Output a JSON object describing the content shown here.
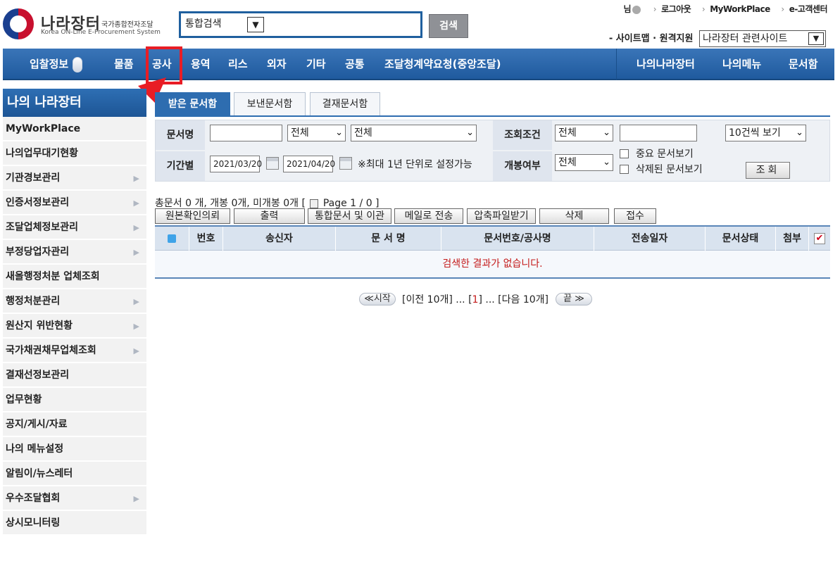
{
  "header": {
    "logo_name": "나라장터",
    "logo_tagline": "국가종합전자조달",
    "logo_english": "Korea ON-Line E-Procurement System",
    "search_scope": "통합검색",
    "search_button": "검색",
    "util_user": "님",
    "util_logout": "로그아웃",
    "util_workplace": "MyWorkPlace",
    "util_customer": "e-고객센터",
    "util_sitemap": "- 사이트맵 · 원격지원",
    "related_sites": "나라장터 관련사이트"
  },
  "nav": {
    "items": [
      "입찰정보",
      "물품",
      "공사",
      "용역",
      "리스",
      "외자",
      "기타",
      "공통",
      "조달청계약요청(중앙조달)"
    ],
    "right_items": [
      "나의나라장터",
      "나의메뉴",
      "문서함"
    ]
  },
  "sidebar": {
    "title": "나의 나라장터",
    "items": [
      {
        "label": "MyWorkPlace",
        "chevron": ""
      },
      {
        "label": "나의업무대기현황",
        "chevron": ""
      },
      {
        "label": "기관경보관리",
        "chevron": "▶"
      },
      {
        "label": "인증서정보관리",
        "chevron": "▶"
      },
      {
        "label": "조달업체정보관리",
        "chevron": "▶"
      },
      {
        "label": "부정당업자관리",
        "chevron": "▶"
      },
      {
        "label": "새올행정처분 업체조회",
        "chevron": ""
      },
      {
        "label": "행정처분관리",
        "chevron": "▶"
      },
      {
        "label": "원산지 위반현황",
        "chevron": "▶"
      },
      {
        "label": "국가채권채무업체조회",
        "chevron": "▶"
      },
      {
        "label": "결재선정보관리",
        "chevron": ""
      },
      {
        "label": "업무현황",
        "chevron": ""
      },
      {
        "label": "공지/게시/자료",
        "chevron": ""
      },
      {
        "label": "나의 메뉴설정",
        "chevron": ""
      },
      {
        "label": "알림이/뉴스레터",
        "chevron": ""
      },
      {
        "label": "우수조달협회",
        "chevron": "▶"
      },
      {
        "label": "상시모니터링",
        "chevron": ""
      }
    ]
  },
  "tabs": [
    "받은 문서함",
    "보낸문서함",
    "결재문서함"
  ],
  "filter": {
    "doc_name_label": "문서명",
    "doc_name_value": "",
    "doc_type_1": "전체",
    "doc_type_2": "전체",
    "query_cond_label": "조회조건",
    "query_cond_value": "전체",
    "query_text_value": "",
    "page_size": "10건씩 보기",
    "period_label": "기간별",
    "date_from": "2021/03/20",
    "date_to": "2021/04/20",
    "period_note": "※최대 1년 단위로 설정가능",
    "open_label": "개봉여부",
    "open_value": "전체",
    "important_label": "중요 문서보기",
    "deleted_label": "삭제된 문서보기",
    "query_button": "조회"
  },
  "summary": "총문서 0 개, 개봉 0개, 미개봉 0개 [",
  "summary_page": "Page 1 / 0 ]",
  "actions": [
    "원본확인의뢰",
    "출력",
    "통합문서 및 이관",
    "메일로 전송",
    "압축파일받기",
    "삭제",
    "접수"
  ],
  "table": {
    "headers": [
      "번호",
      "송신자",
      "문 서 명",
      "문서번호/공사명",
      "전송일자",
      "문서상태",
      "첨부"
    ],
    "empty_message": "검색한 결과가 없습니다."
  },
  "pager": {
    "first": "≪시작",
    "prev": "[이전 10개] ... [",
    "current": "1",
    "next": "] ... [다음 10개]",
    "last": "끝 ≫"
  },
  "colors": {
    "nav_bg": "#2a67aa",
    "active_tab": "#2e6db0",
    "highlight": "#e81d25",
    "empty_text": "#c41a1a"
  }
}
